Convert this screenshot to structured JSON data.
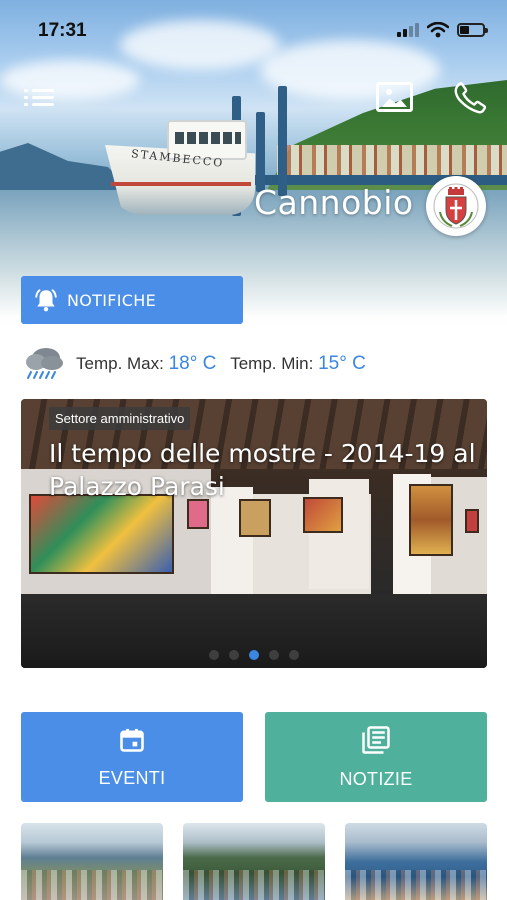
{
  "status_bar": {
    "time": "17:31",
    "icons": [
      "signal-icon",
      "wifi-icon",
      "battery-icon"
    ]
  },
  "header": {
    "menu_icon": "menu-icon",
    "gallery_icon": "image-gallery-icon",
    "phone_icon": "phone-icon",
    "town_name": "Cannobio",
    "boat_name": "STAMBECCO",
    "crest_icon": "town-crest-icon"
  },
  "notifications": {
    "icon": "bell-icon",
    "label": "NOTIFICHE"
  },
  "weather": {
    "icon": "rain-cloud-icon",
    "max_label": "Temp. Max:",
    "max_value": "18° C",
    "min_label": "Temp. Min:",
    "min_value": "15° C"
  },
  "slider": {
    "category": "Settore amministrativo",
    "title": "Il tempo delle mostre - 2014-19 al Palazzo Parasi",
    "dots_count": 5,
    "active_dot": 2
  },
  "actions": {
    "eventi": {
      "label": "EVENTI",
      "icon": "calendar-icon"
    },
    "notizie": {
      "label": "NOTIZIE",
      "icon": "newspaper-icon"
    }
  },
  "thumbnails": [
    "webcam-thumbnail-1",
    "webcam-thumbnail-2",
    "webcam-thumbnail-3"
  ],
  "colors": {
    "primary_blue": "#4a8ee8",
    "accent_blue": "#3a86e0",
    "teal": "#4fb09c"
  }
}
